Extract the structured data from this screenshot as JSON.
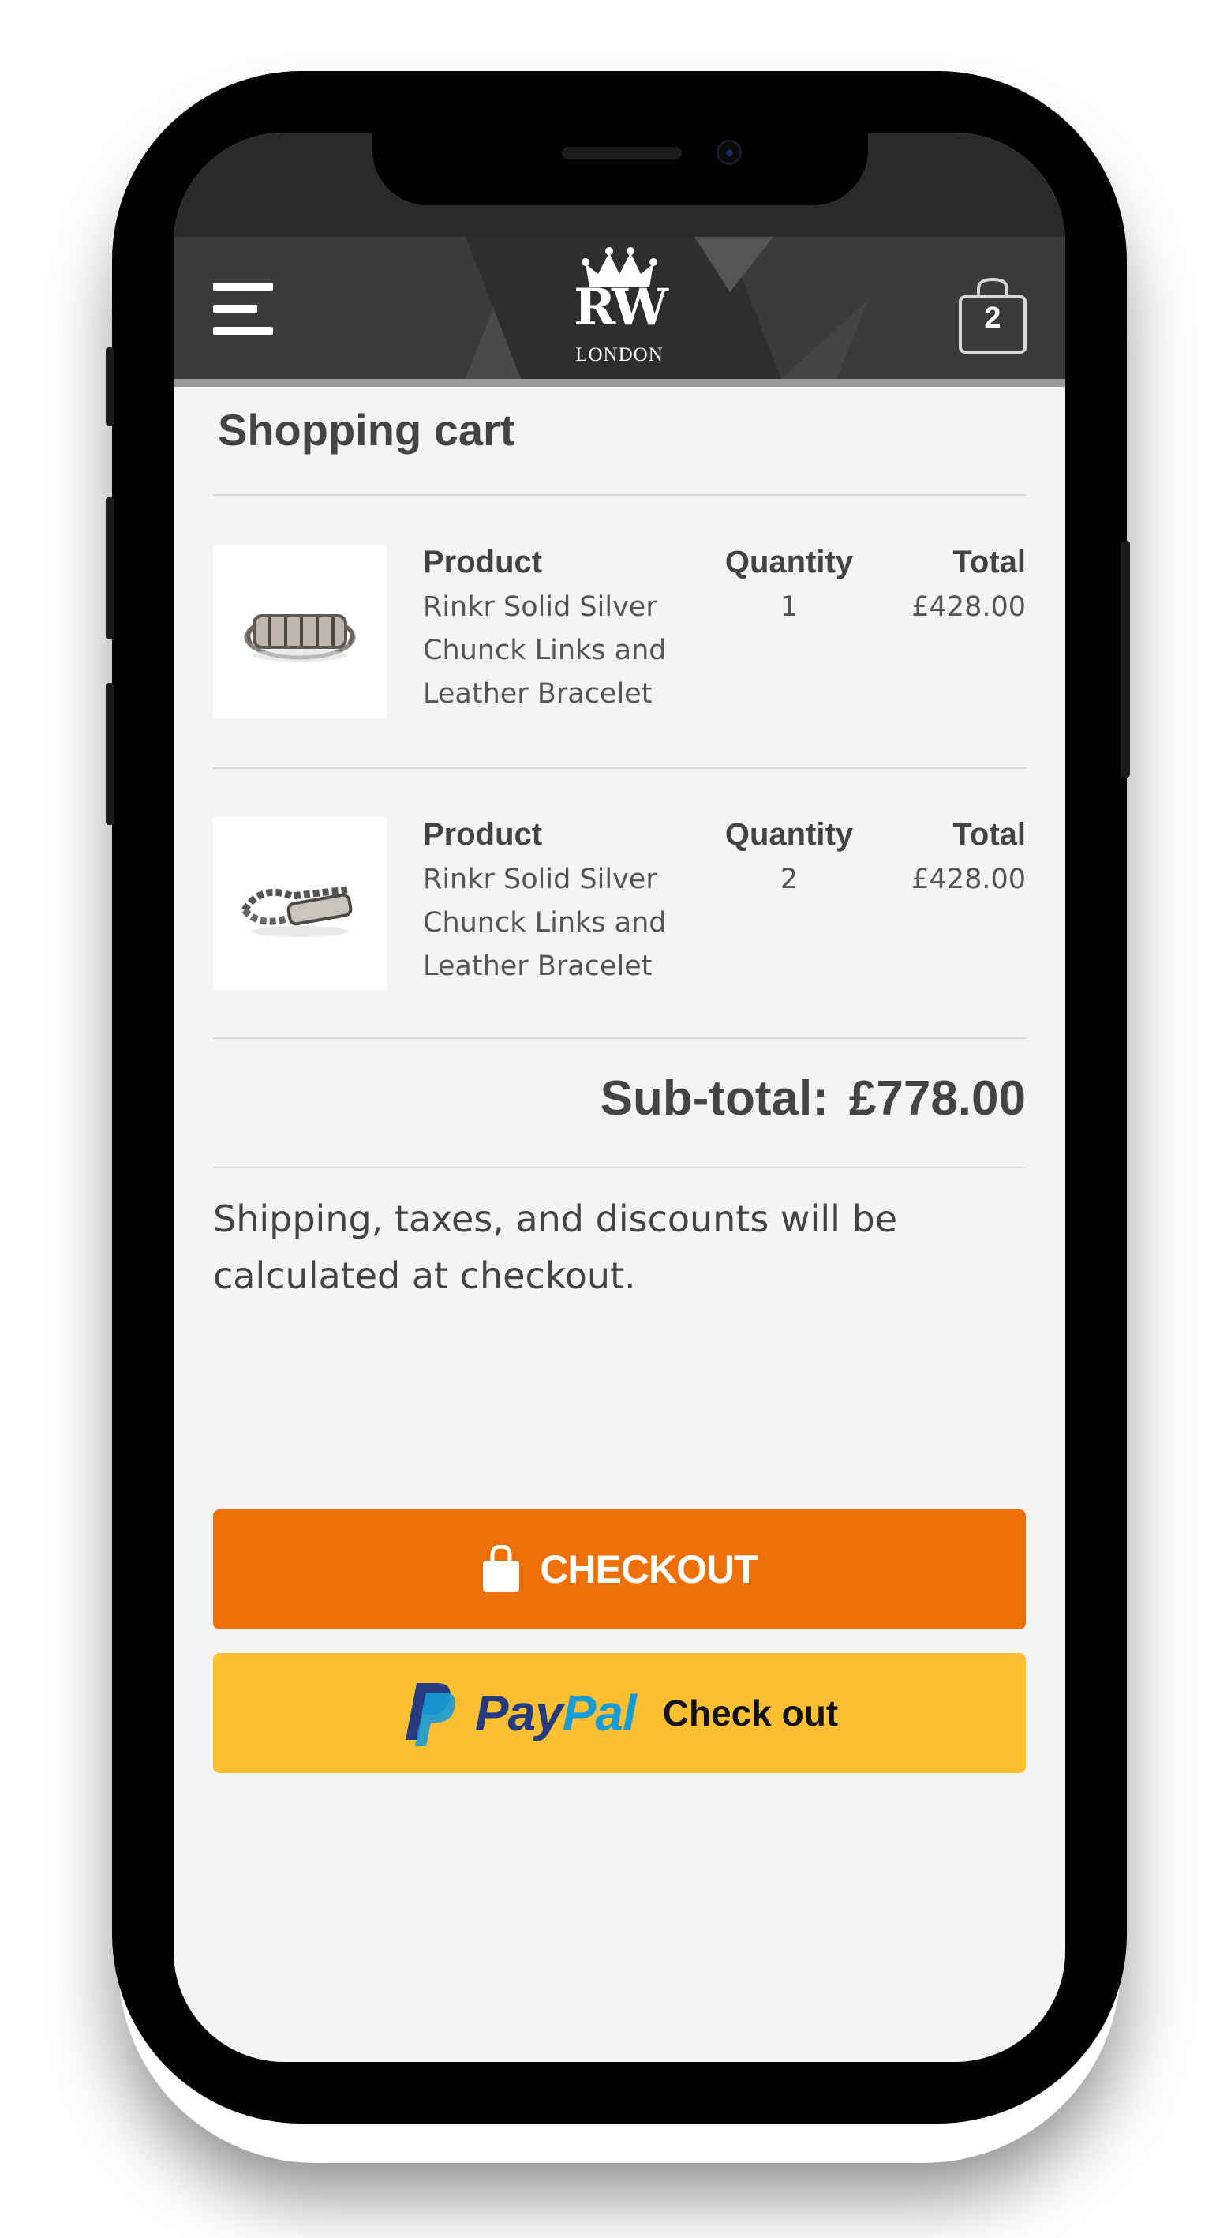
{
  "header": {
    "logo_monogram": "RW",
    "logo_subtitle": "LONDON",
    "cart_count": "2"
  },
  "cart": {
    "title": "Shopping cart",
    "columns": {
      "product": "Product",
      "quantity": "Quantity",
      "total": "Total"
    },
    "items": [
      {
        "name": "Rinkr Solid Silver Chunck Links and Leather Bracelet",
        "quantity": "1",
        "total": "£428.00",
        "image": "bracelet-chunky"
      },
      {
        "name": "Rinkr Solid Silver Chunck Links and Leather Bracelet",
        "quantity": "2",
        "total": "£428.00",
        "image": "bracelet-chain"
      }
    ],
    "subtotal_label": "Sub-total:",
    "subtotal_value": "£778.00",
    "shipping_note": "Shipping, taxes, and discounts will be calculated at checkout."
  },
  "buttons": {
    "checkout_label": "CHECKOUT",
    "paypal_pay": "Pay",
    "paypal_pal": "Pal",
    "paypal_checkout": "Check out"
  },
  "colors": {
    "checkout": "#ed6f05",
    "paypal_button": "#fdc033",
    "header": "#3b3b3b",
    "paypal_dark_blue": "#253b80",
    "paypal_light_blue": "#179bd7"
  }
}
